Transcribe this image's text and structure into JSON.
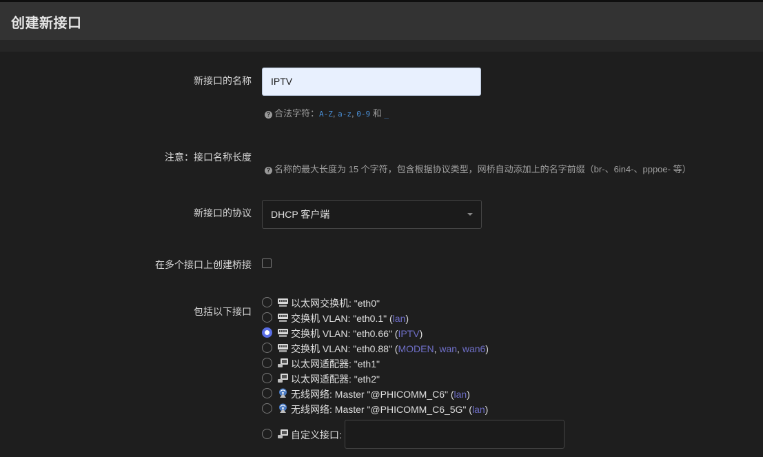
{
  "header": {
    "title": "创建新接口"
  },
  "form": {
    "name_label": "新接口的名称",
    "name_value": "IPTV",
    "name_hint": {
      "prefix": "合法字符：",
      "c1": "A-Z",
      "sep1": ", ",
      "c2": "a-z",
      "sep2": ", ",
      "c3": "0-9",
      "and": " 和 ",
      "c4": "_"
    },
    "note_label": "注意：接口名称长度",
    "note_hint": "名称的最大长度为 15 个字符，包含根据协议类型，网桥自动添加上的名字前缀（br-、6in4-、pppoe- 等）",
    "protocol_label": "新接口的协议",
    "protocol_value": "DHCP 客户端",
    "bridge_label": "在多个接口上创建桥接",
    "bridge_checked": false,
    "include_label": "包括以下接口",
    "selected_index": 2,
    "interfaces": [
      {
        "icon": "switch-icon",
        "text": "以太网交换机: \"eth0\""
      },
      {
        "icon": "switch-icon",
        "text": "交换机 VLAN: \"eth0.1\"",
        "nets": [
          "lan"
        ]
      },
      {
        "icon": "switch-icon",
        "text": "交换机 VLAN: \"eth0.66\"",
        "nets": [
          "IPTV"
        ]
      },
      {
        "icon": "switch-icon",
        "text": "交换机 VLAN: \"eth0.88\"",
        "nets": [
          "MODEN",
          "wan",
          "wan6"
        ]
      },
      {
        "icon": "ethernet-icon",
        "text": "以太网适配器: \"eth1\""
      },
      {
        "icon": "ethernet-icon",
        "text": "以太网适配器: \"eth2\""
      },
      {
        "icon": "wifi-icon",
        "text": "无线网络: Master \"@PHICOMM_C6\"",
        "nets": [
          "lan"
        ]
      },
      {
        "icon": "wifi-icon",
        "text": "无线网络: Master \"@PHICOMM_C6_5G\"",
        "nets": [
          "lan"
        ]
      }
    ],
    "custom_label": "自定义接口:",
    "custom_value": ""
  },
  "colors": {
    "accent": "#5a6ee6",
    "net_link": "#6f6fc8",
    "code": "#4a8fd6"
  }
}
